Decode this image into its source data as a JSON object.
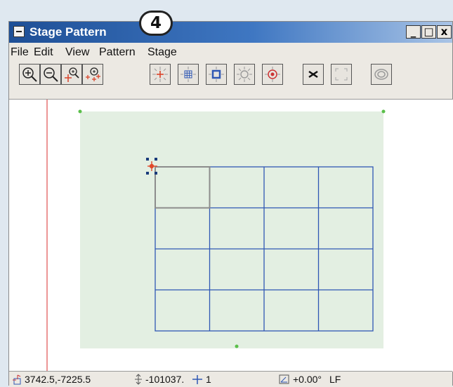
{
  "window": {
    "title": "Stage Pattern",
    "step_badge": "4",
    "minimize_label": "_",
    "maximize_label": "□",
    "close_label": "x"
  },
  "menu": [
    "File",
    "Edit",
    "View",
    "Pattern",
    "Stage"
  ],
  "toolbar": {
    "icons": [
      "zoom-in-icon",
      "zoom-out-icon",
      "zoom-to-point-icon",
      "zoom-to-pattern-icon",
      "center-stage-icon",
      "grid-pattern-icon",
      "selection-box-icon",
      "focus-burst-icon",
      "target-icon",
      "remove-point-icon",
      "expand-view-icon",
      "ring-icon"
    ]
  },
  "colors": {
    "canvas_bg": "#ffffff",
    "pattern_area": "#e3efe2",
    "grid_line": "#2f57b4",
    "selected_cell": "#8c8c8c",
    "corner_marker": "#5abf4a",
    "stage_origin": "#e0492a",
    "handles": "#1a3b7a",
    "guide_line": "#e05050"
  },
  "pattern": {
    "rows": 4,
    "columns": 4,
    "selected_cell": [
      1,
      1
    ]
  },
  "status": {
    "coordinates": "3742.5,-7225.5",
    "z_position": "-101037.",
    "step": "1",
    "rotation": "+0.00°",
    "mode": "LF"
  }
}
